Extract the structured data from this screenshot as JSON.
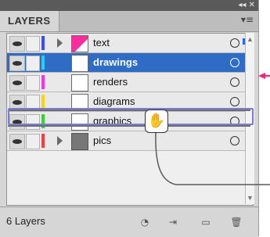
{
  "panel": {
    "tab_label": "LAYERS",
    "window_controls": "◂◂ ✕",
    "panel_menu_icon": "menu-icon"
  },
  "layers": [
    {
      "name": "text",
      "color": "#3b4cff",
      "thumbnail": "pink",
      "expand": true,
      "selected": false,
      "has_selection_square": true
    },
    {
      "name": "drawings",
      "color": "#23d0ff",
      "thumbnail": "white",
      "expand": false,
      "selected": true
    },
    {
      "name": "renders",
      "color": "#ff2cf5",
      "thumbnail": "white",
      "expand": false,
      "selected": false
    },
    {
      "name": "diagrams",
      "color": "#ffd400",
      "thumbnail": "white",
      "expand": false,
      "selected": false
    },
    {
      "name": "graphics",
      "color": "#2fd92f",
      "thumbnail": "white",
      "expand": false,
      "selected": false
    },
    {
      "name": "pics",
      "color": "#ff3b3b",
      "thumbnail": "gray",
      "expand": true,
      "selected": false,
      "has_corner_marker": true
    }
  ],
  "footer": {
    "layer_count": "6 Layers"
  },
  "drag": {
    "cursor": "grabbing-hand-icon"
  },
  "annotations": {
    "callout_colors": {
      "selected_arrow": "#ff1f7a",
      "drag_arrow": "#5a5a5a"
    }
  }
}
